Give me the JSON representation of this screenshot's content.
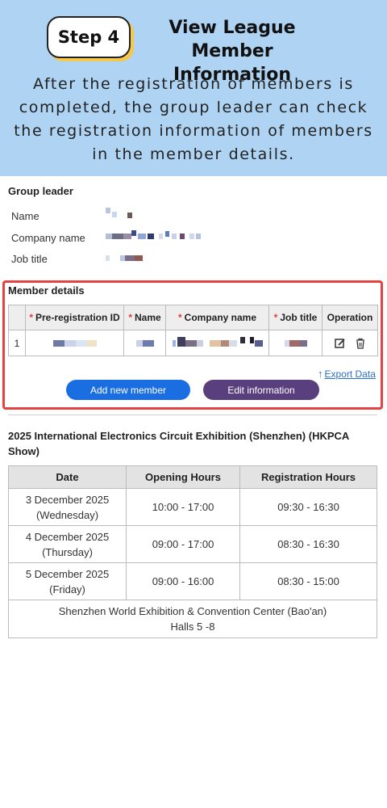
{
  "banner": {
    "step_label": "Step 4",
    "title_line1": "View League",
    "title_line2": "Member Information",
    "description": "After the registration of members is completed, the group leader can check the registration information of members in the member details."
  },
  "group_leader": {
    "title": "Group leader",
    "fields": [
      {
        "label": "Name"
      },
      {
        "label": "Company name"
      },
      {
        "label": "Job title"
      }
    ]
  },
  "member_details": {
    "title": "Member details",
    "columns": [
      "",
      "Pre-registration ID",
      "Name",
      "Company name",
      "Job title",
      "Operation"
    ],
    "required_columns": [
      1,
      2,
      3,
      4
    ],
    "rows": [
      {
        "index": "1"
      }
    ],
    "operation_icons": [
      "edit-icon",
      "trash-icon"
    ],
    "export_label": "Export Data",
    "add_button": "Add new member",
    "edit_button": "Edit information"
  },
  "exhibition": {
    "title": "2025 International Electronics Circuit Exhibition (Shenzhen) (HKPCA Show)",
    "columns": [
      "Date",
      "Opening Hours",
      "Registration Hours"
    ],
    "rows": [
      {
        "date_line1": "3 December 2025",
        "date_line2": "(Wednesday)",
        "opening": "10:00 - 17:00",
        "registration": "09:30 - 16:30"
      },
      {
        "date_line1": "4 December 2025",
        "date_line2": "(Thursday)",
        "opening": "09:00 - 17:00",
        "registration": "08:30 - 16:30"
      },
      {
        "date_line1": "5 December 2025",
        "date_line2": "(Friday)",
        "opening": "09:00 - 16:00",
        "registration": "08:30 - 15:00"
      }
    ],
    "venue_line1": "Shenzhen World Exhibition & Convention Center (Bao'an)",
    "venue_line2": "Halls 5 -8"
  },
  "colors": {
    "banner_bg": "#aed3f3",
    "highlight_border": "#e24444",
    "primary_button": "#1a6ee2",
    "secondary_button": "#5a3f7e",
    "link": "#2a6fc9"
  }
}
